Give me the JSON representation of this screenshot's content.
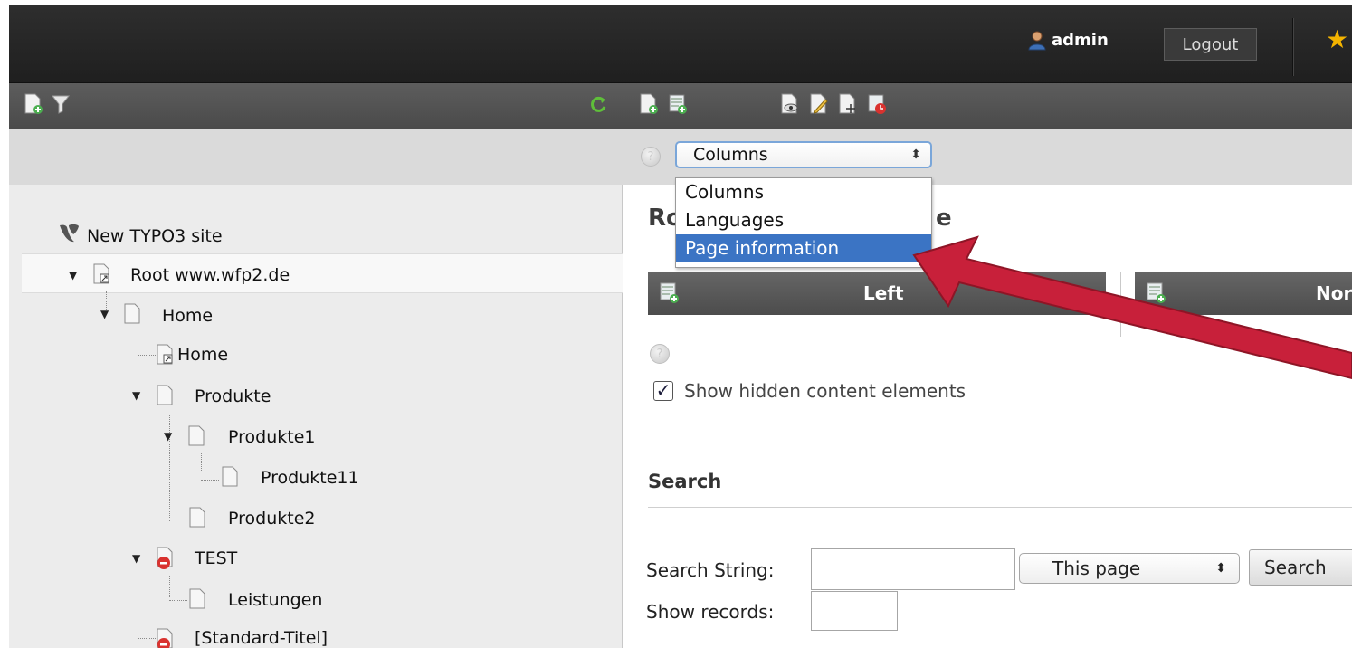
{
  "topbar": {
    "username": "admin",
    "logout_label": "Logout"
  },
  "doc": {
    "view_select": {
      "value": "Columns",
      "options": [
        "Columns",
        "Languages",
        "Page information"
      ],
      "highlighted": "Page information"
    },
    "page_heading_start": "Ro",
    "page_heading_end": "e",
    "columns": [
      {
        "label": "Left"
      },
      {
        "label": "Nor"
      }
    ],
    "show_hidden_label": "Show hidden content elements",
    "show_hidden_checked": true,
    "search": {
      "heading": "Search",
      "string_label": "Search String:",
      "string_value": "",
      "scope_value": "This page",
      "button_label": "Search",
      "records_label": "Show records:",
      "records_value": ""
    }
  },
  "tree": {
    "site_label": "New TYPO3 site",
    "nodes": [
      {
        "label": "Root www.wfp2.de"
      },
      {
        "label": "Home"
      },
      {
        "label": "Home"
      },
      {
        "label": "Produkte"
      },
      {
        "label": "Produkte1"
      },
      {
        "label": "Produkte11"
      },
      {
        "label": "Produkte2"
      },
      {
        "label": "TEST"
      },
      {
        "label": "Leistungen"
      },
      {
        "label": "[Standard-Titel]"
      }
    ]
  },
  "colors": {
    "accent_selection": "#3b74c4",
    "arrow": "#c8203a",
    "toolbar": "#555555",
    "topbar": "#262626"
  }
}
